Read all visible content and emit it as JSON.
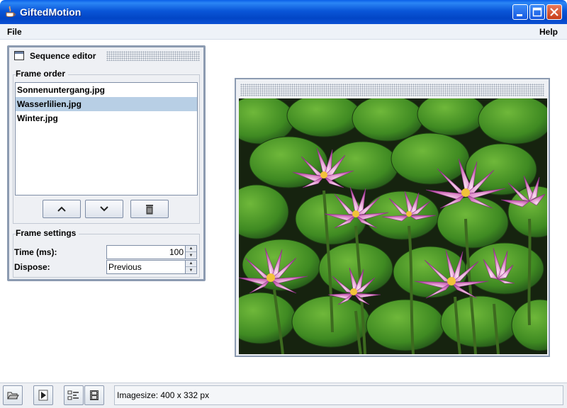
{
  "window": {
    "title": "GiftedMotion",
    "controls": [
      "minimize-icon",
      "maximize-icon",
      "close-icon"
    ]
  },
  "menubar": {
    "file": "File",
    "help": "Help"
  },
  "sequence_editor": {
    "title": "Sequence editor",
    "frame_order_label": "Frame order",
    "frames": [
      "Sonnenuntergang.jpg",
      "Wasserlilien.jpg",
      "Winter.jpg"
    ],
    "selected_frame": "Wasserlilien.jpg",
    "buttons": {
      "up_icon": "chevron-up-icon",
      "down_icon": "chevron-down-icon",
      "delete_icon": "trash-icon"
    },
    "frame_settings_label": "Frame settings",
    "time_label": "Time (ms):",
    "time_value": "100",
    "dispose_label": "Dispose:",
    "dispose_value": "Previous"
  },
  "preview": {
    "image_subject": "pink water lilies among green lily pads"
  },
  "statusbar": {
    "buttons": [
      "open-folder-icon",
      "play-icon",
      "sequence-editor-icon",
      "film-strip-icon"
    ],
    "status_text": "Imagesize: 400 x 332 px"
  },
  "colors": {
    "titlebar": "#0a56d8",
    "selection": "#b8cfe5",
    "frame_border": "#8c9bb1"
  }
}
